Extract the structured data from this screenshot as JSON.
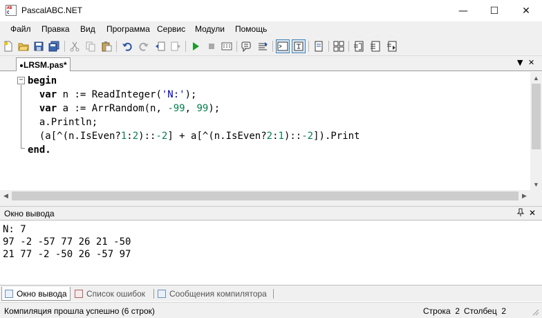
{
  "window": {
    "title": "PascalABC.NET",
    "minimize": "—",
    "maximize": "☐",
    "close": "✕"
  },
  "menu": [
    "Файл",
    "Правка",
    "Вид",
    "Программа",
    "Сервис",
    "Модули",
    "Помощь"
  ],
  "toolbar": {
    "buttons": [
      "new-file",
      "open-file",
      "save-file",
      "save-all",
      "cut",
      "copy",
      "paste",
      "undo",
      "redo",
      "previous-step",
      "next-step",
      "run",
      "stop",
      "compile",
      "comment-block",
      "uncomment-block",
      "console-output",
      "text-output",
      "toggle-panel",
      "format-code",
      "debug-in",
      "debug-over",
      "debug-out"
    ]
  },
  "tabs": {
    "active_file": "LRSM.pas*",
    "dropdown": "▼",
    "close": "✕"
  },
  "editor": {
    "lines": [
      [
        {
          "t": "begin",
          "c": "kw"
        }
      ],
      [
        {
          "t": "  "
        },
        {
          "t": "var",
          "c": "kw"
        },
        {
          "t": " n := ReadInteger("
        },
        {
          "t": "'N:'",
          "c": "str"
        },
        {
          "t": ");"
        }
      ],
      [
        {
          "t": "  "
        },
        {
          "t": "var",
          "c": "kw"
        },
        {
          "t": " a := ArrRandom(n, "
        },
        {
          "t": "-99",
          "c": "num"
        },
        {
          "t": ", "
        },
        {
          "t": "99",
          "c": "num"
        },
        {
          "t": ");"
        }
      ],
      [
        {
          "t": "  a.Println;"
        }
      ],
      [
        {
          "t": "  (a[^(n.IsEven?"
        },
        {
          "t": "1",
          "c": "num"
        },
        {
          "t": ":"
        },
        {
          "t": "2",
          "c": "num"
        },
        {
          "t": ")::"
        },
        {
          "t": "-2",
          "c": "num"
        },
        {
          "t": "] + a[^(n.IsEven?"
        },
        {
          "t": "2",
          "c": "num"
        },
        {
          "t": ":"
        },
        {
          "t": "1",
          "c": "num"
        },
        {
          "t": ")::"
        },
        {
          "t": "-2",
          "c": "num"
        },
        {
          "t": "]).Print"
        }
      ],
      [
        {
          "t": "end.",
          "c": "kw"
        }
      ]
    ]
  },
  "output": {
    "title": "Окно вывода",
    "pin": "⚲",
    "close": "✕",
    "lines": [
      "N: 7",
      "97 -2 -57 77 26 21 -50",
      "21 77 -2 -50 26 -57 97"
    ]
  },
  "bottom_tabs": [
    "Окно вывода",
    "Список ошибок",
    "Сообщения компилятора"
  ],
  "status": {
    "message": "Компиляция прошла успешно (6 строк)",
    "row": "Строка  2",
    "col": "Столбец  2"
  }
}
